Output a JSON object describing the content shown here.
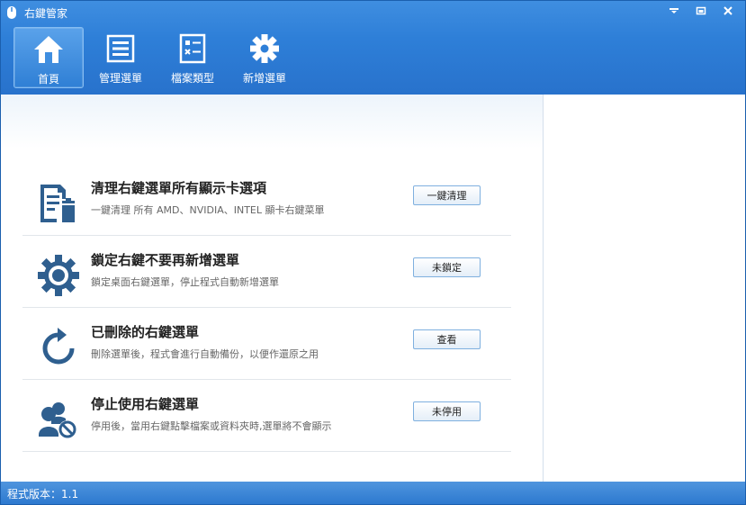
{
  "window": {
    "title": "右鍵管家",
    "controls": [
      "dropdown-icon",
      "restore-icon",
      "close-icon"
    ]
  },
  "toolbar": {
    "items": [
      {
        "label": "首頁",
        "icon": "home-icon",
        "active": true
      },
      {
        "label": "管理選單",
        "icon": "list-icon",
        "active": false
      },
      {
        "label": "檔案類型",
        "icon": "filetype-icon",
        "active": false
      },
      {
        "label": "新增選單",
        "icon": "gear-icon",
        "active": false
      }
    ]
  },
  "main": {
    "items": [
      {
        "title": "清理右鍵選單所有顯示卡選項",
        "desc": "一鍵清理 所有 AMD、NVIDIA、INTEL 顯卡右鍵菜單",
        "button": "一鍵清理",
        "icon": "clean-document-icon"
      },
      {
        "title": "鎖定右鍵不要再新增選單",
        "desc": "鎖定桌面右鍵選單，停止程式自動新增選單",
        "button": "未鎖定",
        "icon": "lock-gear-icon"
      },
      {
        "title": "已刪除的右鍵選單",
        "desc": "刪除選單後，程式會進行自動備份，以便作還原之用",
        "button": "查看",
        "icon": "restore-arrow-icon"
      },
      {
        "title": "停止使用右鍵選單",
        "desc": "停用後，當用右鍵點擊檔案或資料夾時,選單將不會顯示",
        "button": "未停用",
        "icon": "user-disable-icon"
      }
    ]
  },
  "status": {
    "version": "程式版本：1.1"
  },
  "colors": {
    "header": "#2e7fd8",
    "statusbar": "#2d79cf",
    "icon": "#2f5f8f"
  }
}
